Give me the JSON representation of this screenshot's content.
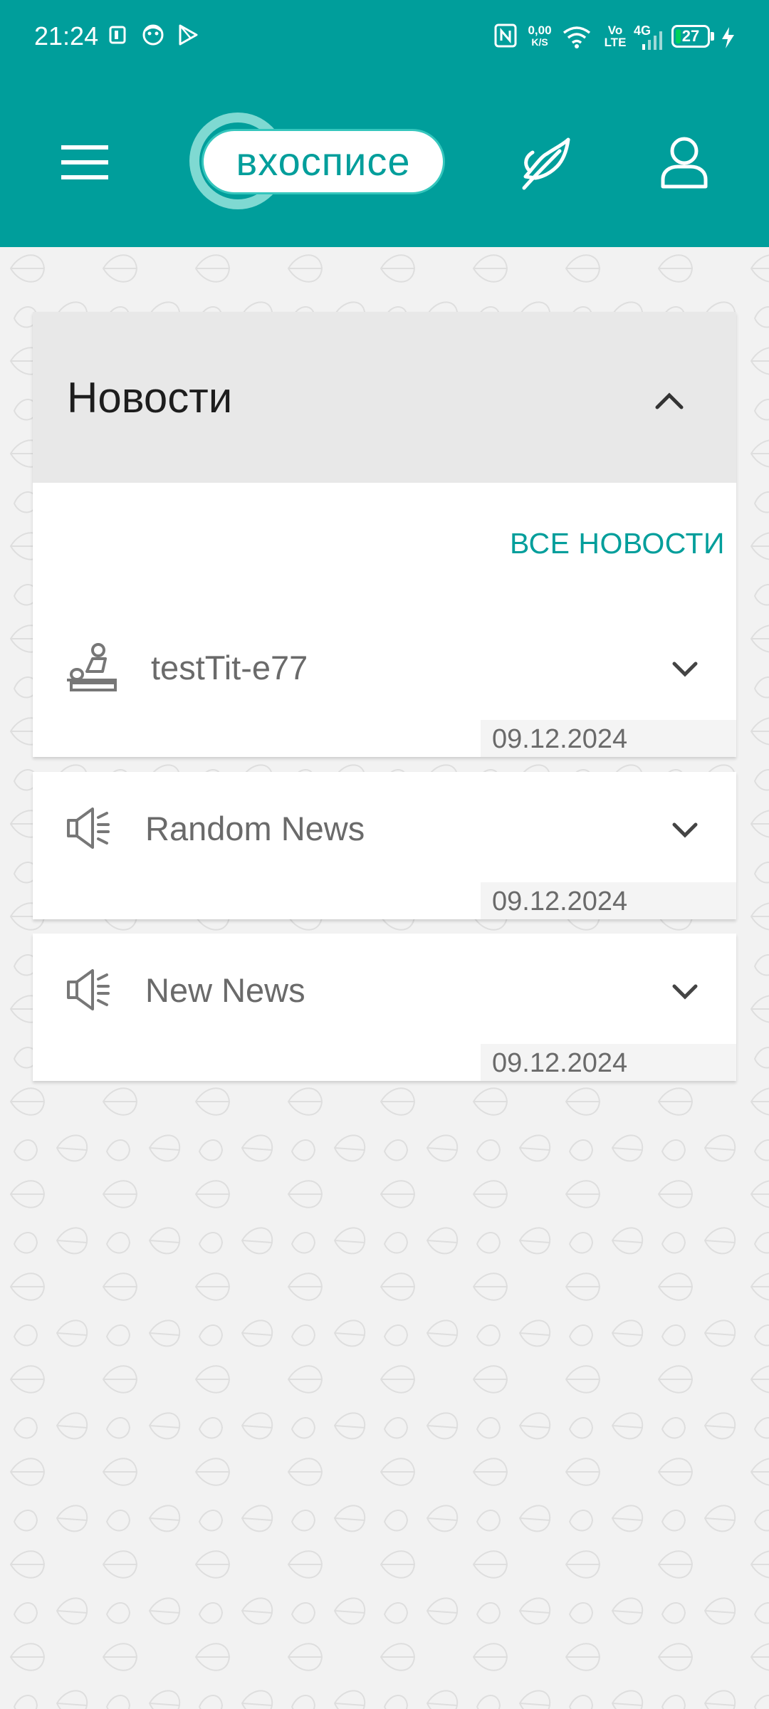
{
  "status_bar": {
    "time": "21:24",
    "net_speed_value": "0,00",
    "net_speed_unit": "K/S",
    "volte_top": "Vo",
    "volte_bottom": "LTE",
    "network": "4G",
    "battery": "27",
    "battery_level": 0.27
  },
  "header": {
    "logo_text": "вхосписе",
    "icons": [
      "menu-icon",
      "feather-icon",
      "user-icon"
    ]
  },
  "news_section": {
    "title": "Новости",
    "all_news_link": "ВСЕ НОВОСТИ",
    "items": [
      {
        "title": "testTit-e77",
        "date": "09.12.2024",
        "icon": "massage-icon"
      },
      {
        "title": "Random News",
        "date": "09.12.2024",
        "icon": "megaphone-icon"
      },
      {
        "title": "New News",
        "date": "09.12.2024",
        "icon": "megaphone-icon"
      }
    ]
  },
  "colors": {
    "accent": "#009e9b",
    "background": "#f2f2f2",
    "section_header": "#e8e8e8",
    "text_secondary": "#6a6a6a"
  }
}
